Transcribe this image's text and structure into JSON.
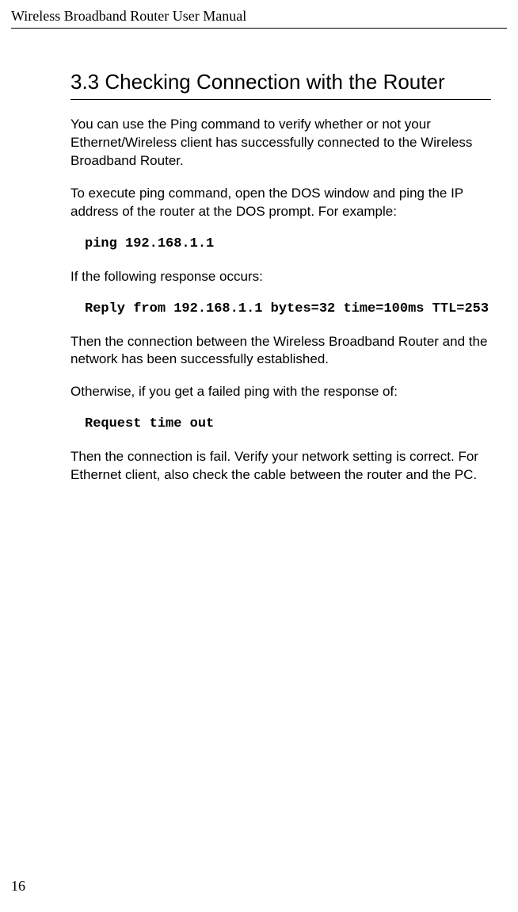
{
  "header": {
    "running_title": "Wireless Broadband Router User Manual"
  },
  "section": {
    "heading": "3.3 Checking Connection with the Router",
    "paragraphs": {
      "p1": "You can use the Ping command to verify whether or not your Ethernet/Wireless client has successfully connected to the Wireless Broadband Router.",
      "p2": "To execute ping command, open the DOS window and ping the IP address of the router at the DOS prompt. For example:",
      "code1": "ping 192.168.1.1",
      "p3": "If the following response occurs:",
      "code2": "Reply from 192.168.1.1 bytes=32 time=100ms TTL=253",
      "p4": "Then the connection between the Wireless Broadband Router and the network has been successfully established.",
      "p5": "Otherwise, if you get a failed ping with the response of:",
      "code3": "Request time out",
      "p6": "Then the connection is fail. Verify your network setting is correct. For Ethernet client, also check the cable between the router and the PC."
    }
  },
  "footer": {
    "page_number": "16"
  }
}
